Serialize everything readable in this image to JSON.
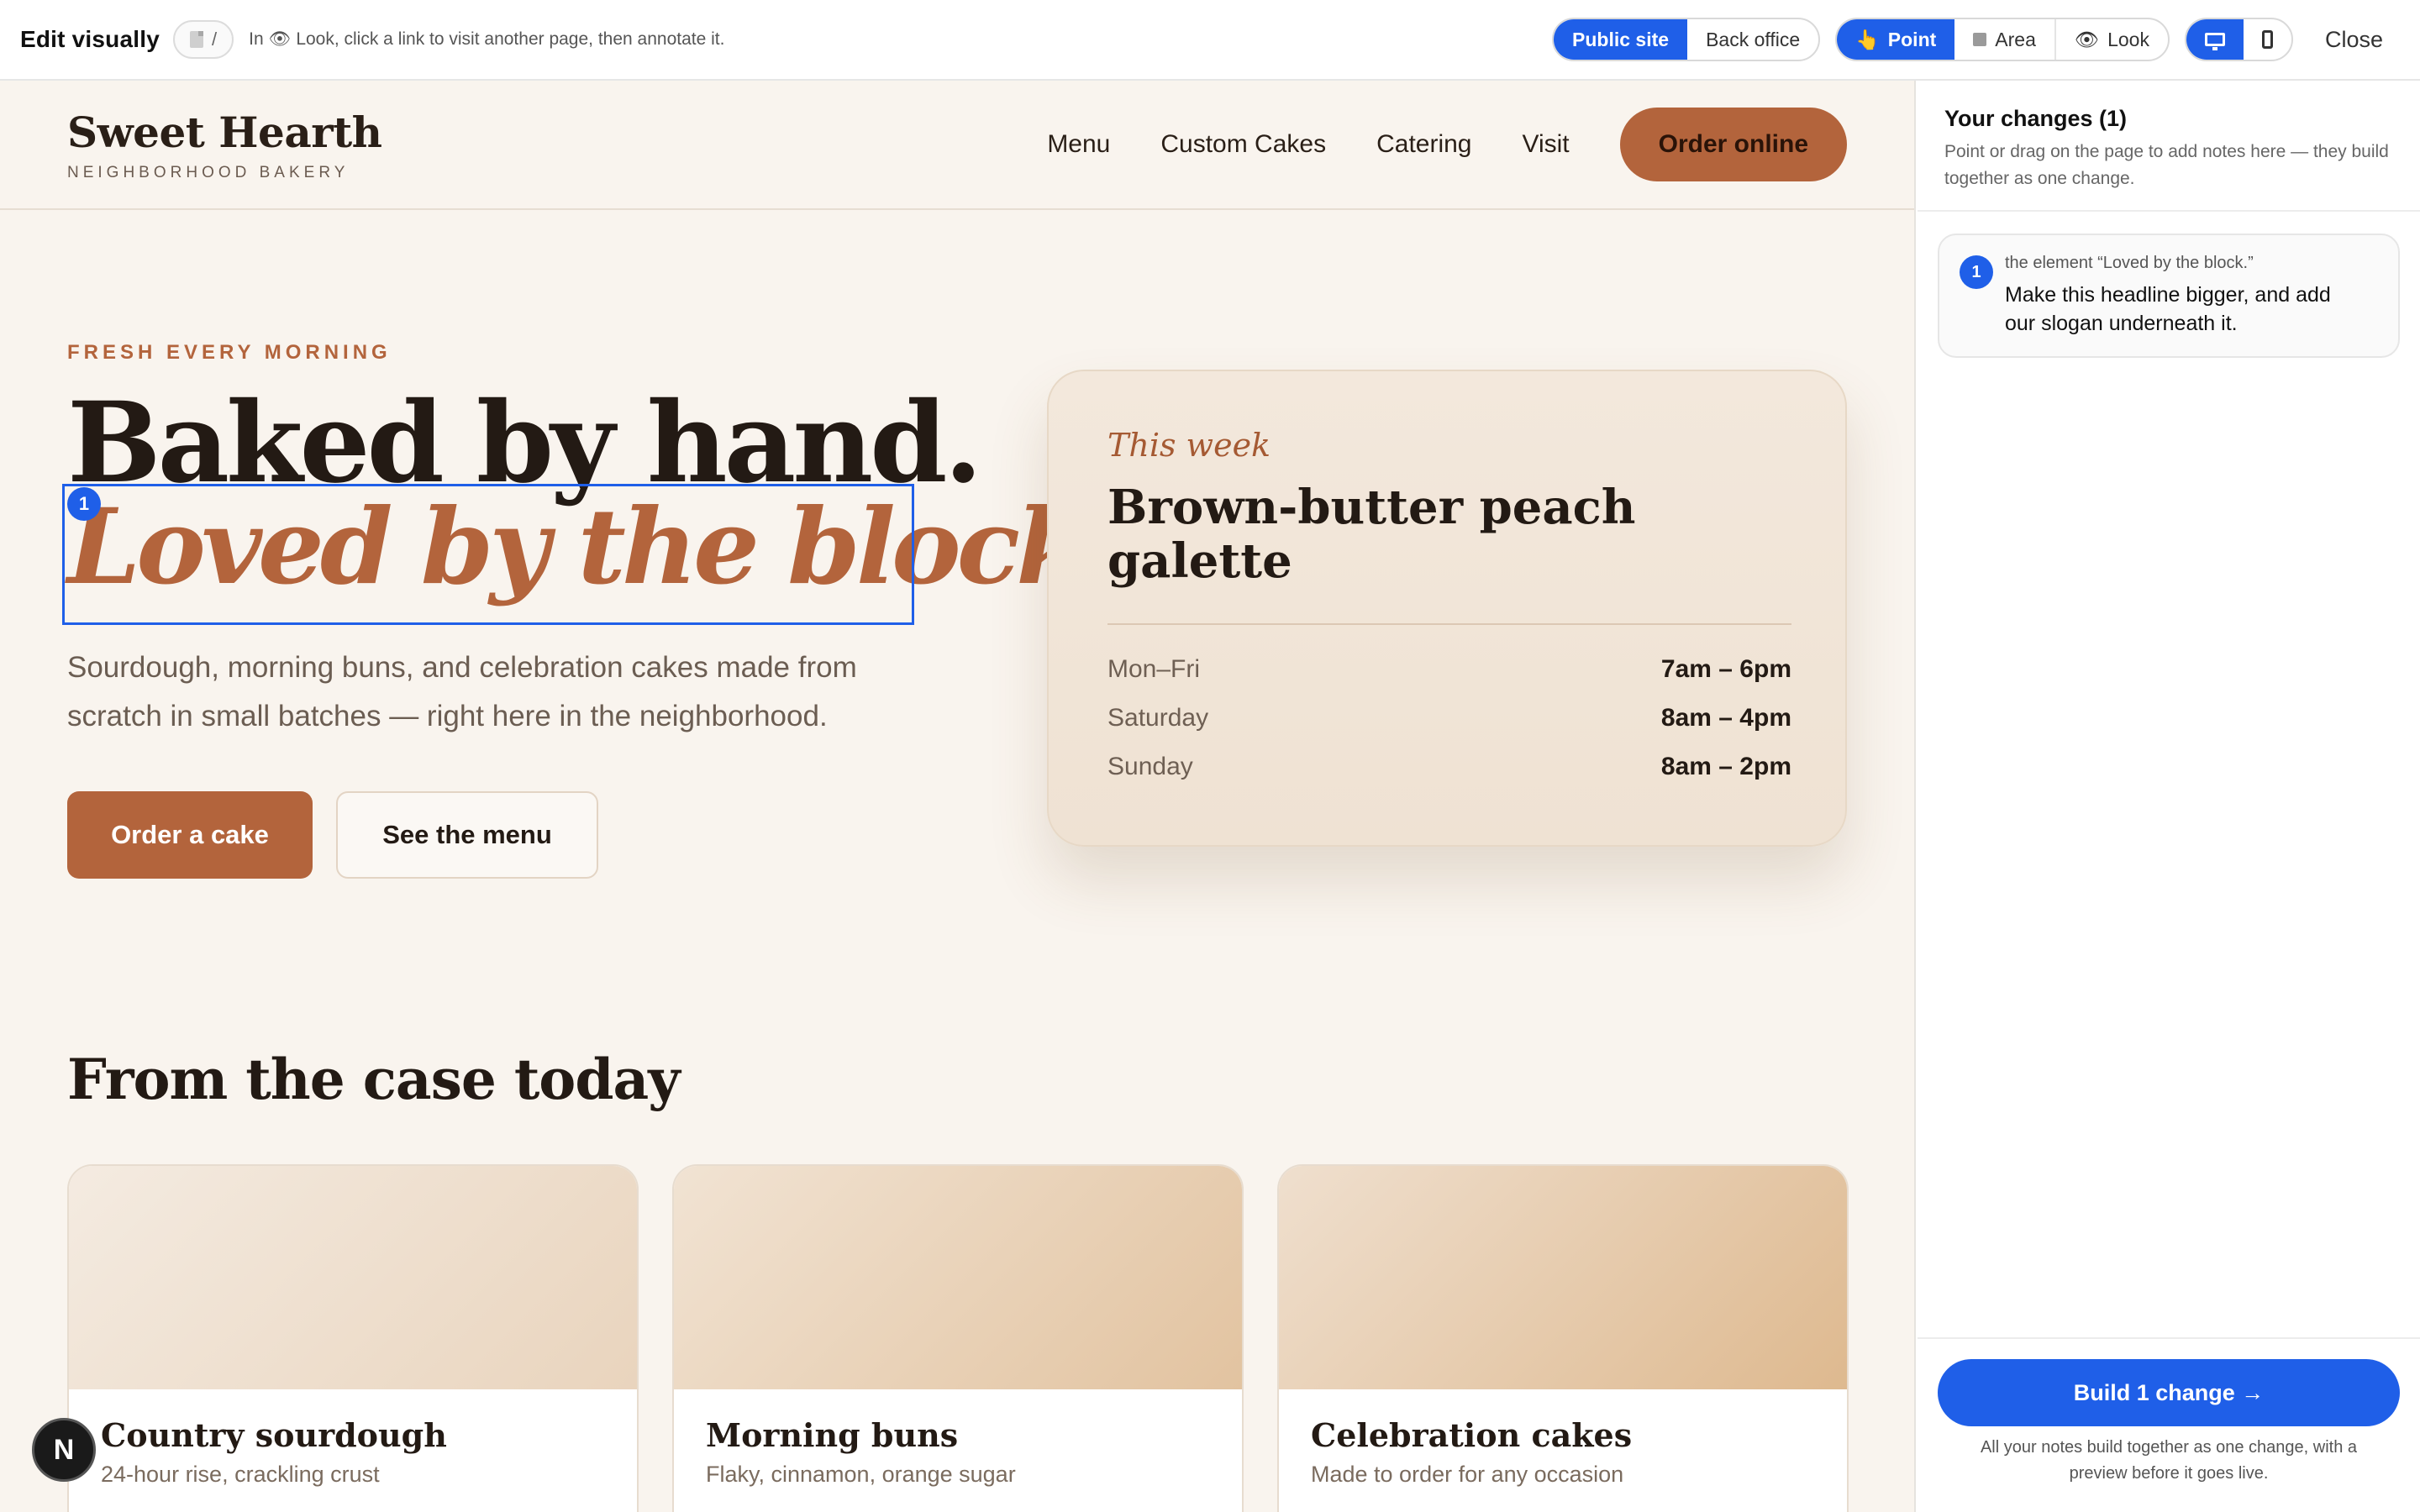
{
  "toolbar": {
    "title": "Edit visually",
    "path": "/",
    "hint_prefix": "In",
    "hint_icon": "eye-icon",
    "hint_text": "Look, click a link to visit another page, then annotate it.",
    "site_toggle": {
      "public": "Public site",
      "back": "Back office"
    },
    "modes": {
      "point": "Point",
      "area": "Area",
      "look": "Look"
    },
    "close": "Close",
    "accent": "#1f5fe8"
  },
  "site": {
    "brand": {
      "name": "Sweet Hearth",
      "tagline": "NEIGHBORHOOD BAKERY"
    },
    "nav": {
      "items": [
        "Menu",
        "Custom Cakes",
        "Catering",
        "Visit"
      ],
      "cta": "Order online"
    },
    "hero": {
      "eyebrow": "FRESH EVERY MORNING",
      "line1": "Baked by hand.",
      "line2": "Loved by the block.",
      "body": "Sourdough, morning buns, and celebration cakes made from scratch in small batches — right here in the neighborhood.",
      "btn_primary": "Order a cake",
      "btn_secondary": "See the menu",
      "annotation_badge": "1"
    },
    "this_week": {
      "label": "This week",
      "item": "Brown-butter peach galette",
      "hours": [
        {
          "day": "Mon–Fri",
          "time": "7am – 6pm"
        },
        {
          "day": "Saturday",
          "time": "8am – 4pm"
        },
        {
          "day": "Sunday",
          "time": "8am – 2pm"
        }
      ]
    },
    "case": {
      "title": "From the case today",
      "products": [
        {
          "name": "Country sourdough",
          "desc": "24-hour rise, crackling crust"
        },
        {
          "name": "Morning buns",
          "desc": "Flaky, cinnamon, orange sugar"
        },
        {
          "name": "Celebration cakes",
          "desc": "Made to order for any occasion"
        }
      ]
    },
    "colors": {
      "accent": "#b3643c",
      "ink": "#231a14",
      "background": "#f9f4ee"
    },
    "framework_badge": "N"
  },
  "panel": {
    "title": "Your changes (1)",
    "subtitle": "Point or drag on the page to add notes here — they build together as one change.",
    "notes": [
      {
        "num": "1",
        "ref": "the element “Loved by the block.”",
        "text": "Make this headline bigger, and add our slogan underneath it."
      }
    ],
    "build_button": "Build 1 change →",
    "footer": "All your notes build together as one change, with a preview before it goes live."
  }
}
